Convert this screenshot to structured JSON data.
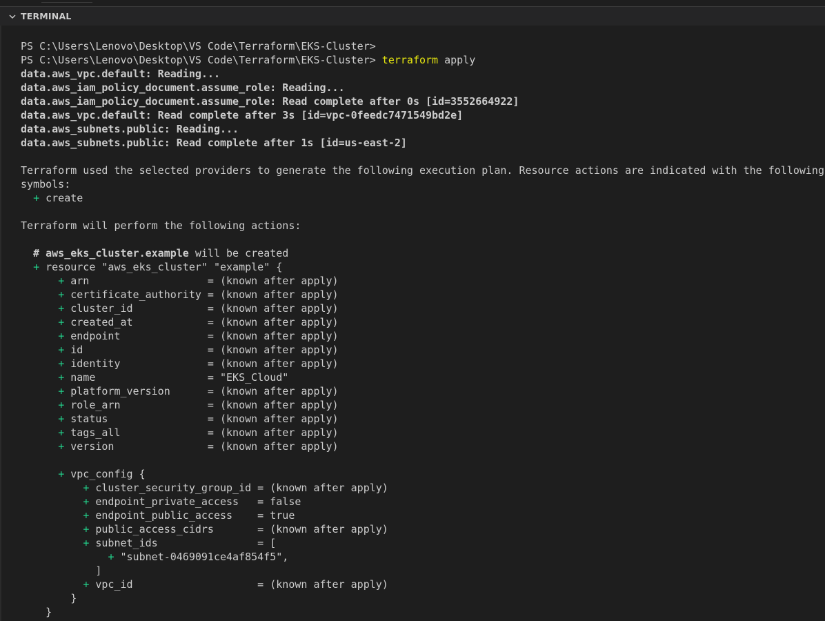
{
  "panel": {
    "title": "TERMINAL"
  },
  "terminal": {
    "lines": [
      {
        "segments": [
          {
            "t": "PS C:\\Users\\Lenovo\\Desktop\\VS Code\\Terraform\\EKS-Cluster>"
          }
        ]
      },
      {
        "segments": [
          {
            "t": "PS C:\\Users\\Lenovo\\Desktop\\VS Code\\Terraform\\EKS-Cluster> "
          },
          {
            "t": "terraform",
            "s": "cmd"
          },
          {
            "t": " apply"
          }
        ]
      },
      {
        "segments": [
          {
            "t": "data.aws_vpc.default: Reading...",
            "s": "bold"
          }
        ]
      },
      {
        "segments": [
          {
            "t": "data.aws_iam_policy_document.assume_role: Reading...",
            "s": "bold"
          }
        ]
      },
      {
        "segments": [
          {
            "t": "data.aws_iam_policy_document.assume_role: Read complete after 0s [id=3552664922]",
            "s": "bold"
          }
        ]
      },
      {
        "segments": [
          {
            "t": "data.aws_vpc.default: Read complete after 3s [id=vpc-0feedc7471549bd2e]",
            "s": "bold"
          }
        ]
      },
      {
        "segments": [
          {
            "t": "data.aws_subnets.public: Reading...",
            "s": "bold"
          }
        ]
      },
      {
        "segments": [
          {
            "t": "data.aws_subnets.public: Read complete after 1s [id=us-east-2]",
            "s": "bold"
          }
        ]
      },
      {
        "segments": [
          {
            "t": ""
          }
        ]
      },
      {
        "segments": [
          {
            "t": "Terraform used the selected providers to generate the following execution plan. Resource actions are indicated with the following"
          }
        ]
      },
      {
        "segments": [
          {
            "t": "symbols:"
          }
        ]
      },
      {
        "segments": [
          {
            "t": "  "
          },
          {
            "t": "+",
            "s": "plus"
          },
          {
            "t": " create"
          }
        ]
      },
      {
        "segments": [
          {
            "t": ""
          }
        ]
      },
      {
        "segments": [
          {
            "t": "Terraform will perform the following actions:"
          }
        ]
      },
      {
        "segments": [
          {
            "t": ""
          }
        ]
      },
      {
        "segments": [
          {
            "t": "  # ",
            "s": "bold"
          },
          {
            "t": "aws_eks_cluster.example",
            "s": "bold"
          },
          {
            "t": " will be created"
          }
        ]
      },
      {
        "segments": [
          {
            "t": "  "
          },
          {
            "t": "+",
            "s": "plus"
          },
          {
            "t": " resource \"aws_eks_cluster\" \"example\" {"
          }
        ]
      },
      {
        "segments": [
          {
            "t": "      "
          },
          {
            "t": "+",
            "s": "plus"
          },
          {
            "t": " arn                   = (known after apply)"
          }
        ]
      },
      {
        "segments": [
          {
            "t": "      "
          },
          {
            "t": "+",
            "s": "plus"
          },
          {
            "t": " certificate_authority = (known after apply)"
          }
        ]
      },
      {
        "segments": [
          {
            "t": "      "
          },
          {
            "t": "+",
            "s": "plus"
          },
          {
            "t": " cluster_id            = (known after apply)"
          }
        ]
      },
      {
        "segments": [
          {
            "t": "      "
          },
          {
            "t": "+",
            "s": "plus"
          },
          {
            "t": " created_at            = (known after apply)"
          }
        ]
      },
      {
        "segments": [
          {
            "t": "      "
          },
          {
            "t": "+",
            "s": "plus"
          },
          {
            "t": " endpoint              = (known after apply)"
          }
        ]
      },
      {
        "segments": [
          {
            "t": "      "
          },
          {
            "t": "+",
            "s": "plus"
          },
          {
            "t": " id                    = (known after apply)"
          }
        ]
      },
      {
        "segments": [
          {
            "t": "      "
          },
          {
            "t": "+",
            "s": "plus"
          },
          {
            "t": " identity              = (known after apply)"
          }
        ]
      },
      {
        "segments": [
          {
            "t": "      "
          },
          {
            "t": "+",
            "s": "plus"
          },
          {
            "t": " name                  = \"EKS_Cloud\""
          }
        ]
      },
      {
        "segments": [
          {
            "t": "      "
          },
          {
            "t": "+",
            "s": "plus"
          },
          {
            "t": " platform_version      = (known after apply)"
          }
        ]
      },
      {
        "segments": [
          {
            "t": "      "
          },
          {
            "t": "+",
            "s": "plus"
          },
          {
            "t": " role_arn              = (known after apply)"
          }
        ]
      },
      {
        "segments": [
          {
            "t": "      "
          },
          {
            "t": "+",
            "s": "plus"
          },
          {
            "t": " status                = (known after apply)"
          }
        ]
      },
      {
        "segments": [
          {
            "t": "      "
          },
          {
            "t": "+",
            "s": "plus"
          },
          {
            "t": " tags_all              = (known after apply)"
          }
        ]
      },
      {
        "segments": [
          {
            "t": "      "
          },
          {
            "t": "+",
            "s": "plus"
          },
          {
            "t": " version               = (known after apply)"
          }
        ]
      },
      {
        "segments": [
          {
            "t": ""
          }
        ]
      },
      {
        "segments": [
          {
            "t": "      "
          },
          {
            "t": "+",
            "s": "plus"
          },
          {
            "t": " vpc_config {"
          }
        ]
      },
      {
        "segments": [
          {
            "t": "          "
          },
          {
            "t": "+",
            "s": "plus"
          },
          {
            "t": " cluster_security_group_id = (known after apply)"
          }
        ]
      },
      {
        "segments": [
          {
            "t": "          "
          },
          {
            "t": "+",
            "s": "plus"
          },
          {
            "t": " endpoint_private_access   = false"
          }
        ]
      },
      {
        "segments": [
          {
            "t": "          "
          },
          {
            "t": "+",
            "s": "plus"
          },
          {
            "t": " endpoint_public_access    = true"
          }
        ]
      },
      {
        "segments": [
          {
            "t": "          "
          },
          {
            "t": "+",
            "s": "plus"
          },
          {
            "t": " public_access_cidrs       = (known after apply)"
          }
        ]
      },
      {
        "segments": [
          {
            "t": "          "
          },
          {
            "t": "+",
            "s": "plus"
          },
          {
            "t": " subnet_ids                = ["
          }
        ]
      },
      {
        "segments": [
          {
            "t": "              "
          },
          {
            "t": "+",
            "s": "plus"
          },
          {
            "t": " \"subnet-0469091ce4af854f5\","
          }
        ]
      },
      {
        "segments": [
          {
            "t": "            ]"
          }
        ]
      },
      {
        "segments": [
          {
            "t": "          "
          },
          {
            "t": "+",
            "s": "plus"
          },
          {
            "t": " vpc_id                    = (known after apply)"
          }
        ]
      },
      {
        "segments": [
          {
            "t": "        }"
          }
        ]
      },
      {
        "segments": [
          {
            "t": "    }"
          }
        ]
      }
    ]
  }
}
